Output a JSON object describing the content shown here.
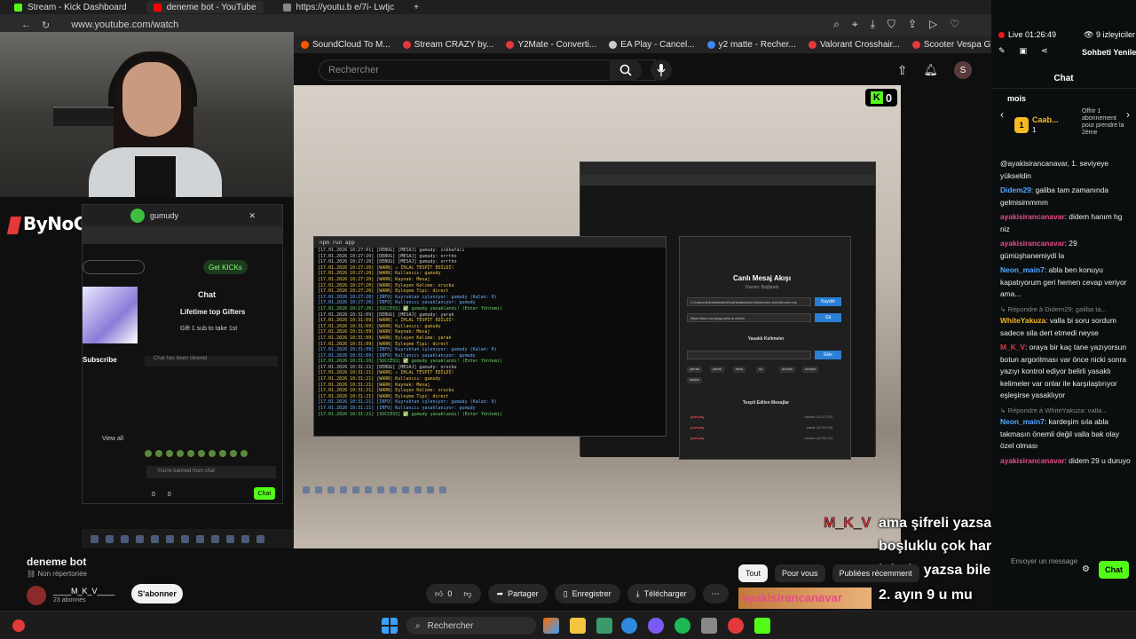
{
  "browser": {
    "tabs": [
      {
        "label": "Stream - Kick Dashboard",
        "color": "#53fc18"
      },
      {
        "label": "deneme bot - YouTube",
        "color": "#ff0000"
      },
      {
        "label": "https://youtu.b e/7i- Lwtjc",
        "color": "#888888"
      }
    ],
    "url": "www.youtube.com/watch",
    "bookmarks": [
      {
        "label": "SoundCloud To M...",
        "color": "#ff5500"
      },
      {
        "label": "Stream CRAZY by...",
        "color": "#e23a3a"
      },
      {
        "label": "Y2Mate - Converti...",
        "color": "#e23a3a"
      },
      {
        "label": "EA Play - Cancel...",
        "color": "#cccccc"
      },
      {
        "label": "y2 matte - Recher...",
        "color": "#4285f4"
      },
      {
        "label": "Valorant Crosshair...",
        "color": "#e23a3a"
      },
      {
        "label": "Scooter Vespa GT...",
        "color": "#e23a3a"
      }
    ]
  },
  "youtube": {
    "search_placeholder": "Rechercher",
    "avatar_letter": "S",
    "video_title": "deneme bot",
    "visibility": "Non répertoriée",
    "channel_name": "____M_K_V____",
    "channel_subs": "23 abonnés",
    "subscribe": "S'abonner",
    "likes": "0",
    "share": "Partager",
    "save": "Enregistrer",
    "download": "Télécharger",
    "filters": [
      "Tout",
      "Pour vous",
      "Publiées récemment"
    ]
  },
  "overlay": {
    "brand": "ByNoGame",
    "kick_counter": "0",
    "mkv_name": "M_K_V",
    "captions": [
      "ama şifreli yazsa bile yakalıyor",
      "boşluklu çok harfli veya gelime",
      "içinde yazsa bile yakalıyor",
      "2. ayın 9 u mu"
    ],
    "ayakis_label": "ayakisirancanavar"
  },
  "mini_chat": {
    "user": "gumudy",
    "get_kicks": "Get KICKs",
    "chat_title": "Chat",
    "lifetime": "Lifetime top Gifters",
    "gift": "Gift 1 sub to take 1st",
    "subscribe": "Subscribe",
    "cleared": "Chat has been cleared",
    "view_all": "View all",
    "banned": "You're banned from chat",
    "count_a": "0",
    "count_b": "0",
    "chat_btn": "Chat"
  },
  "video_content": {
    "terminal_title": "npm run app",
    "terminal_lines": [
      "[17.01.2026 10:27:01] [DEBUG] [MESAJ] gumudy: sikkafali",
      "[17.01.2026 10:27:20] [DEBUG] [MESAJ] gumudy: orrtho",
      "[17.01.2026 10:27:20] [DEBUG] [MESAJ] gumudy: orrtho",
      "[17.01.2026 10:27:20] [WARN]  ⚠ İHLAL TESPİT EDİLDİ!",
      "[17.01.2026 10:27:20] [WARN]    Kullanıcı: gumudy",
      "[17.01.2026 10:27:20] [WARN]    Kaynak: Mesaj",
      "[17.01.2026 10:27:20] [WARN]    Eşleşen Kelime: orucbu",
      "[17.01.2026 10:27:20] [WARN]    Eşleşme Tipi: direct",
      "[17.01.2026 10:27:20] [INFO] Kuyruktan işleniyor: gumudy (Kalan: 0)",
      "[17.01.2026 10:27:20] [INFO] Kullanıcı yasaklanıyor: gumudy",
      "[17.01.2026 10:27:20] [SUCCESS] ✅ gumudy yasaklandı! (Enter Yöntemi)",
      "[17.01.2026 10:31:09] [DEBUG] [MESAJ] gumudy: yarak",
      "[17.01.2026 10:31:09] [WARN]  ⚠ İHLAL TESPİT EDİLDİ!",
      "[17.01.2026 10:31:09] [WARN]    Kullanıcı: gumudy",
      "[17.01.2026 10:31:09] [WARN]    Kaynak: Mesaj",
      "[17.01.2026 10:31:09] [WARN]    Eşleşen Kelime: yarak",
      "[17.01.2026 10:31:09] [WARN]    Eşleşme Tipi: direct",
      "[17.01.2026 10:31:09] [INFO] Kuyruktan işleniyor: gumudy (Kalan: 0)",
      "[17.01.2026 10:31:09] [INFO] Kullanıcı yasaklanıyor: gumudy",
      "[17.01.2026 10:31:10] [SUCCESS] ✅ gumudy yasaklandı! (Enter Yöntemi)",
      "[17.01.2026 10:31:21] [DEBUG] [MESAJ] gumudy: orucbu",
      "[17.01.2026 10:31:21] [WARN]  ⚠ İHLAL TESPİT EDİLDİ!",
      "[17.01.2026 10:31:21] [WARN]    Kullanıcı: gumudy",
      "[17.01.2026 10:31:21] [WARN]    Kaynak: Mesaj",
      "[17.01.2026 10:31:21] [WARN]    Eşleşen Kelime: orucbu",
      "[17.01.2026 10:31:21] [WARN]    Eşleşme Tipi: direct",
      "[17.01.2026 10:31:21] [INFO] Kuyruktan işleniyor: gumudy (Kalan: 0)",
      "[17.01.2026 10:31:21] [INFO] Kullanıcı yasaklanıyor: gumudy",
      "[17.01.2026 10:31:21] [SUCCESS] ✅ gumudy yasaklandı! (Enter Yöntemi)"
    ],
    "modal_title": "Canlı Mesaj Akışı",
    "modal_sub": "Durum: Bağlandı",
    "path_value": "C:\\Users\\Administrator\\Downloads\\kick-bot\\chrome-win\\chrome.exe",
    "url_value": "https://kick.com/popout/m-k-v/chat",
    "save_btn": "Kaydet",
    "go_btn": "Git",
    "banned_words_head": "Yasaklı Kelimeler",
    "add_btn": "Ekle",
    "tags": [
      "yarrak",
      "yarak",
      "amq",
      "oç",
      "orucbu",
      "orospu",
      "kahpe"
    ],
    "detected_head": "Tespit Edilen Mesajlar",
    "detected_rows": [
      {
        "user": "gumudy",
        "info": "orucbu (10:27:20)"
      },
      {
        "user": "gumudy",
        "info": "yarak (10:31:09)"
      },
      {
        "user": "gumudy",
        "info": "orucbu (10:31:21)"
      }
    ]
  },
  "kick_panel": {
    "live_time": "Live 01:26:49",
    "viewers": "9 izleyiciler",
    "refresh": "Sohbeti Yenile",
    "chat_title": "Chat",
    "period": "mois",
    "leader_name": "Caab...",
    "leader_rank": "1",
    "leader_value": "1",
    "offer_text": "Offrir 1 abonnement pour prendre la 2ème",
    "messages": [
      {
        "type": "msg",
        "user": "",
        "color": "#efefef",
        "text": "@ayakisirancanavar, 1. seviyeye yükseldin"
      },
      {
        "type": "msg",
        "user": "Didem29",
        "color": "#53a6ff",
        "text": "galiba tam zamanında gelmisimmmm"
      },
      {
        "type": "msg",
        "user": "ayakisirancanavar",
        "color": "#e84a8a",
        "text": "didem hanım hg niz"
      },
      {
        "type": "msg",
        "user": "ayakisirancanavar",
        "color": "#e84a8a",
        "text": "29 gümüşhanemiydi la"
      },
      {
        "type": "msg",
        "user": "Neon_main7",
        "color": "#53a6ff",
        "text": "abla ben konuyu kapatıyorum geri hemen cevap veriyor ama..."
      },
      {
        "type": "reply",
        "user": "",
        "color": "#888888",
        "text": "↳ Répondre à Didem29: galiba ta..."
      },
      {
        "type": "msg",
        "user": "WhiteYakuza",
        "color": "#f5b921",
        "text": "valla bi soru sordum sadece sila dert etmedi neyse"
      },
      {
        "type": "msg",
        "user": "M_K_V",
        "color": "#e23a3a",
        "text": "oraya bir kaç tane yazıyorsun botun argoritması var önce nicki sonra yazıyı kontrol ediyor belirli yasaklı kelimeler var onlar ile karşılaştırıyor eşleşirse yasaklıyor"
      },
      {
        "type": "reply",
        "user": "",
        "color": "#888888",
        "text": "↳ Répondre à WhiteYakuza: valla..."
      },
      {
        "type": "msg",
        "user": "Neon_main7",
        "color": "#53a6ff",
        "text": "kardeşim sıla abla takmasın önemli değil valla bak olay özel olması"
      },
      {
        "type": "msg",
        "user": "ayakisirancanavar",
        "color": "#e84a8a",
        "text": "didem 29 u duruyo"
      }
    ],
    "send_placeholder": "Envoyer un message",
    "chat_button": "Chat"
  },
  "taskbar": {
    "search": "Rechercher"
  },
  "colors": {
    "kick_green": "#53fc18",
    "yt_bg": "#0f0f0f",
    "live_red": "#e91916"
  }
}
